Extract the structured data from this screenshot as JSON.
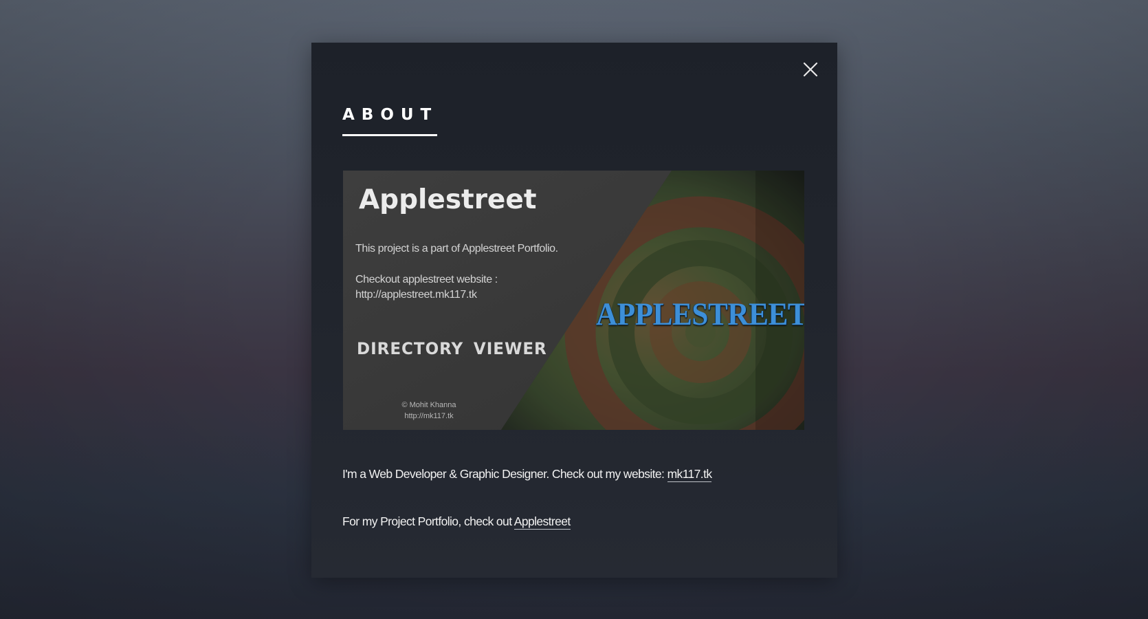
{
  "about_dialog": {
    "title": "ABOUT",
    "close_icon": "close-icon",
    "banner": {
      "app_name": "Applestreet",
      "line1": "This project is a part of Applestreet Portfolio.",
      "line2": "Checkout applestreet website :",
      "line3": "http://applestreet.mk117.tk",
      "product_name": "DIRECTORY VIEWER",
      "logo_text": "APPLESTREET",
      "copyright_line1": "© Mohit Khanna",
      "copyright_line2": "http://mk117.tk",
      "logo_color": "#3d8fd8"
    },
    "description": {
      "line1_text": "I'm a Web Developer & Graphic Designer. Check out my website: ",
      "line1_link": "mk117.tk",
      "line2_text": "For my Project Portfolio, check out ",
      "line2_link": "Applestreet"
    }
  },
  "colors": {
    "modal_background": "#21252d",
    "text": "#f2f2f2",
    "accent_blue": "#3d8fd8"
  }
}
